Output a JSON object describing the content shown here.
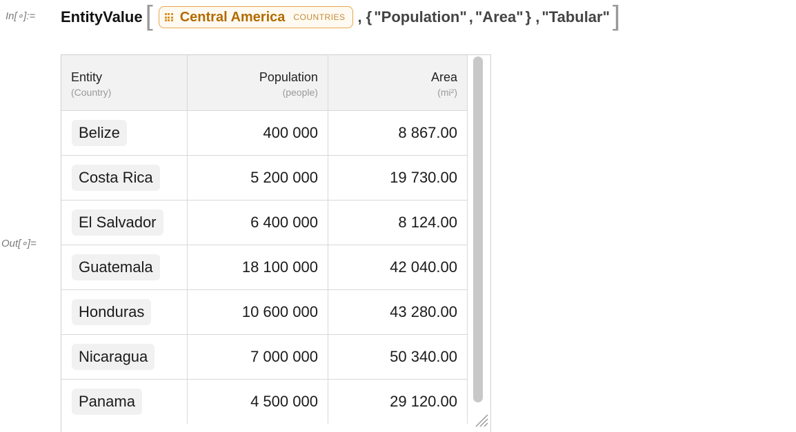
{
  "cell": {
    "in_label": "In[∘]:=",
    "out_label": "Out[∘]=",
    "function_name": "EntityValue",
    "entity": {
      "name": "Central America",
      "type": "COUNTRIES",
      "icon": "entity-class-icon"
    },
    "properties": [
      "\"Population\"",
      "\"Area\""
    ],
    "format_arg": "\"Tabular\""
  },
  "table": {
    "headers": [
      {
        "main": "Entity",
        "sub": "(Country)"
      },
      {
        "main": "Population",
        "sub": "(people)"
      },
      {
        "main": "Area",
        "sub": "(mi²)"
      }
    ],
    "rows": [
      {
        "entity": "Belize",
        "population": "400 000",
        "area": "8 867.00"
      },
      {
        "entity": "Costa Rica",
        "population": "5 200 000",
        "area": "19 730.00"
      },
      {
        "entity": "El Salvador",
        "population": "6 400 000",
        "area": "8 124.00"
      },
      {
        "entity": "Guatemala",
        "population": "18 100 000",
        "area": "42 040.00"
      },
      {
        "entity": "Honduras",
        "population": "10 600 000",
        "area": "43 280.00"
      },
      {
        "entity": "Nicaragua",
        "population": "7 000 000",
        "area": "50 340.00"
      },
      {
        "entity": "Panama",
        "population": "4 500 000",
        "area": "29 120.00"
      }
    ]
  },
  "colors": {
    "entity_accent": "#e8a64a",
    "entity_text": "#b36b00"
  }
}
